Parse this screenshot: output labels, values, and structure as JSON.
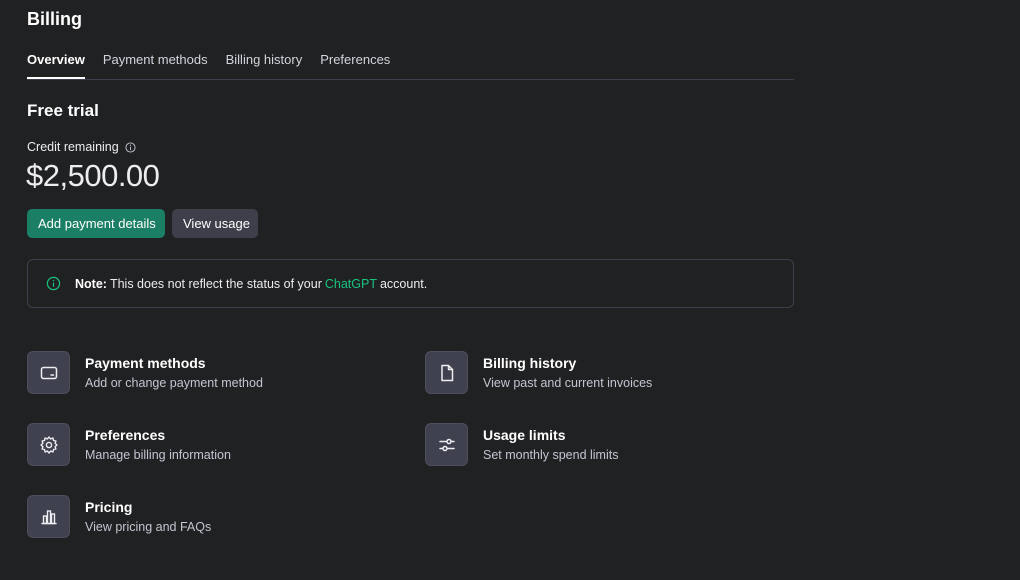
{
  "header": {
    "title": "Billing"
  },
  "tabs": [
    {
      "label": "Overview",
      "active": true
    },
    {
      "label": "Payment methods",
      "active": false
    },
    {
      "label": "Billing history",
      "active": false
    },
    {
      "label": "Preferences",
      "active": false
    }
  ],
  "plan": {
    "title": "Free trial",
    "credit_label": "Credit remaining",
    "credit_amount": "$2,500.00",
    "add_payment_label": "Add payment details",
    "view_usage_label": "View usage"
  },
  "note": {
    "bold": "Note:",
    "text_before": "This does not reflect the status of your",
    "link": "ChatGPT",
    "text_after": "account."
  },
  "cards": [
    {
      "title": "Payment methods",
      "desc": "Add or change payment method",
      "icon": "credit-card-icon"
    },
    {
      "title": "Billing history",
      "desc": "View past and current invoices",
      "icon": "document-icon"
    },
    {
      "title": "Preferences",
      "desc": "Manage billing information",
      "icon": "gear-icon"
    },
    {
      "title": "Usage limits",
      "desc": "Set monthly spend limits",
      "icon": "sliders-icon"
    },
    {
      "title": "Pricing",
      "desc": "View pricing and FAQs",
      "icon": "bar-chart-icon"
    }
  ],
  "colors": {
    "background": "#202123",
    "accent_button": "#1a7f64",
    "link": "#19c37d",
    "tile": "#40414f"
  }
}
